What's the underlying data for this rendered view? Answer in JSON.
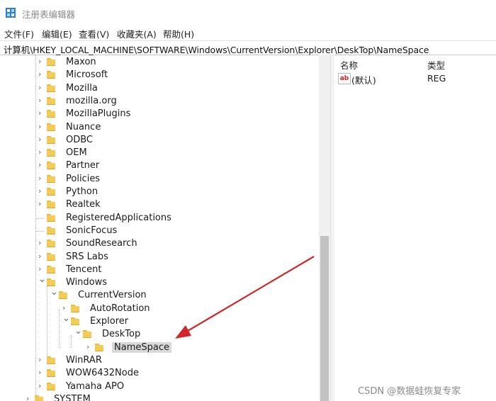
{
  "window": {
    "title": "注册表编辑器",
    "app_icon": "regedit-icon"
  },
  "menu": [
    {
      "label": "文件(F)"
    },
    {
      "label": "编辑(E)"
    },
    {
      "label": "查看(V)"
    },
    {
      "label": "收藏夹(A)"
    },
    {
      "label": "帮助(H)"
    }
  ],
  "address": {
    "path": "计算机\\HKEY_LOCAL_MACHINE\\SOFTWARE\\Windows\\CurrentVersion\\Explorer\\DeskTop\\NameSpace"
  },
  "tree": {
    "nodes": [
      {
        "label": "Maxon",
        "expander": "collapsed"
      },
      {
        "label": "Microsoft",
        "expander": "collapsed"
      },
      {
        "label": "Mozilla",
        "expander": "collapsed"
      },
      {
        "label": "mozilla.org",
        "expander": "collapsed"
      },
      {
        "label": "MozillaPlugins",
        "expander": "collapsed"
      },
      {
        "label": "Nuance",
        "expander": "collapsed"
      },
      {
        "label": "ODBC",
        "expander": "collapsed"
      },
      {
        "label": "OEM",
        "expander": "collapsed"
      },
      {
        "label": "Partner",
        "expander": "collapsed"
      },
      {
        "label": "Policies",
        "expander": "collapsed"
      },
      {
        "label": "Python",
        "expander": "collapsed"
      },
      {
        "label": "Realtek",
        "expander": "collapsed"
      },
      {
        "label": "RegisteredApplications",
        "expander": "none"
      },
      {
        "label": "SonicFocus",
        "expander": "none"
      },
      {
        "label": "SoundResearch",
        "expander": "collapsed"
      },
      {
        "label": "SRS Labs",
        "expander": "collapsed"
      },
      {
        "label": "Tencent",
        "expander": "collapsed"
      },
      {
        "label": "Windows",
        "expander": "expanded"
      },
      {
        "label": "CurrentVersion",
        "expander": "expanded"
      },
      {
        "label": "AutoRotation",
        "expander": "collapsed"
      },
      {
        "label": "Explorer",
        "expander": "expanded"
      },
      {
        "label": "DeskTop",
        "expander": "expanded"
      },
      {
        "label": "NameSpace",
        "expander": "collapsed",
        "selected": true
      },
      {
        "label": "WinRAR",
        "expander": "collapsed"
      },
      {
        "label": "WOW6432Node",
        "expander": "collapsed"
      },
      {
        "label": "Yamaha APO",
        "expander": "collapsed"
      },
      {
        "label": "SYSTEM",
        "expander": "collapsed"
      }
    ]
  },
  "values_pane": {
    "columns": [
      {
        "label": "名称"
      },
      {
        "label": "类型"
      }
    ],
    "rows": [
      {
        "icon": "ab-string-icon",
        "icon_text": "ab",
        "name": "(默认)",
        "type": "REG"
      }
    ]
  },
  "annotation": {
    "arrow_color": "#d0282a"
  },
  "watermark": "CSDN @数据蛙恢复专家",
  "colors": {
    "folder": "#f3cc57",
    "selection": "#d9d9d9",
    "scroll_thumb": "#c2c2c2"
  }
}
